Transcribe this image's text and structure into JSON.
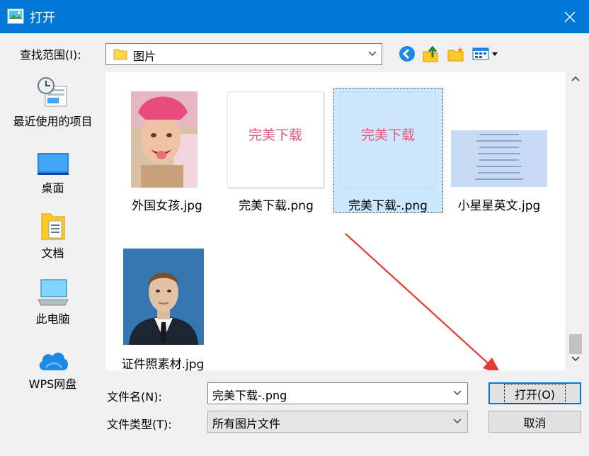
{
  "window": {
    "title": "打开",
    "close_glyph": "✕"
  },
  "lookin": {
    "label": "查找范围(I):",
    "value": "图片"
  },
  "places": [
    {
      "label": "最近使用的项目",
      "icon": "recent-items-icon"
    },
    {
      "label": "桌面",
      "icon": "desktop-icon"
    },
    {
      "label": "文档",
      "icon": "documents-icon"
    },
    {
      "label": "此电脑",
      "icon": "this-pc-icon"
    },
    {
      "label": "WPS网盘",
      "icon": "wps-cloud-icon"
    }
  ],
  "files": [
    {
      "name": "外国女孩.jpg"
    },
    {
      "name": "完美下载.png",
      "thumb_text": "完美下载"
    },
    {
      "name": "完美下载-.png",
      "thumb_text": "完美下载",
      "selected": true
    },
    {
      "name": "小星星英文.jpg"
    },
    {
      "name": "证件照素材.jpg"
    }
  ],
  "filename": {
    "label": "文件名(N):",
    "value": "完美下载-.png"
  },
  "filetype": {
    "label": "文件类型(T):",
    "value": "所有图片文件"
  },
  "buttons": {
    "open": "打开(O)",
    "cancel": "取消"
  },
  "colors": {
    "accent": "#0078d7",
    "selection": "#cce8ff",
    "thumb_text": "#e8557a",
    "arrow": "#e53935"
  }
}
